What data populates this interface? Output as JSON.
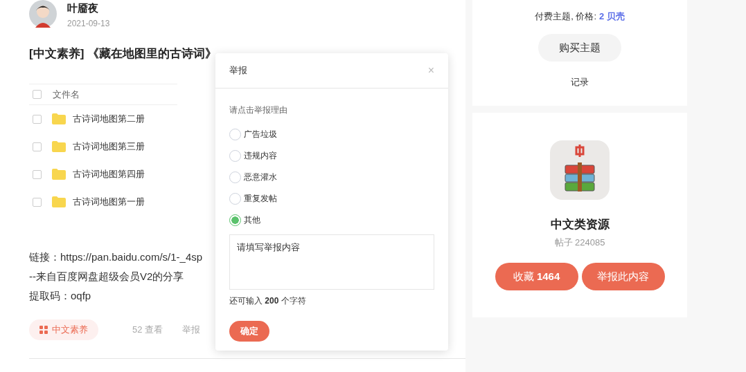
{
  "post": {
    "author": "叶靥夜",
    "date": "2021-09-13",
    "title": "[中文素养] 《藏在地图里的古诗词》",
    "file_table": {
      "header": {
        "label": "文件名",
        "checked": false
      },
      "rows": [
        {
          "name": "古诗词地图第二册",
          "checked": false
        },
        {
          "name": "古诗词地图第三册",
          "checked": false
        },
        {
          "name": "古诗词地图第四册",
          "checked": false
        },
        {
          "name": "古诗词地图第一册",
          "checked": false
        }
      ]
    },
    "lines": [
      "链接：https://pan.baidu.com/s/1-_4sp",
      "--来自百度网盘超级会员V2的分享",
      "提取码：oqfp"
    ],
    "tag": "中文素养",
    "views": "52 查看",
    "report": "举报"
  },
  "sidebar": {
    "price_label": "付费主题, 价格:",
    "price_value": "2 贝壳",
    "buy_button": "购买主题",
    "records_link": "记录",
    "forum": {
      "name": "中文类资源",
      "posts": "帖子 224085",
      "favorite_button": "收藏 **1464**",
      "report_button": "举报此内容"
    }
  },
  "report_dialog": {
    "title": "举报",
    "close": "×",
    "prompt": "请点击举报理由",
    "reasons": [
      {
        "label": "广告垃圾",
        "selected": false
      },
      {
        "label": "违规内容",
        "selected": false
      },
      {
        "label": "恶意灌水",
        "selected": false
      },
      {
        "label": "重复发帖",
        "selected": false
      },
      {
        "label": "其他",
        "selected": true
      }
    ],
    "content_field": {
      "placeholder": "请填写举报内容"
    },
    "counter": "还可输入 **200** 个字符",
    "confirm_button": "确定"
  }
}
